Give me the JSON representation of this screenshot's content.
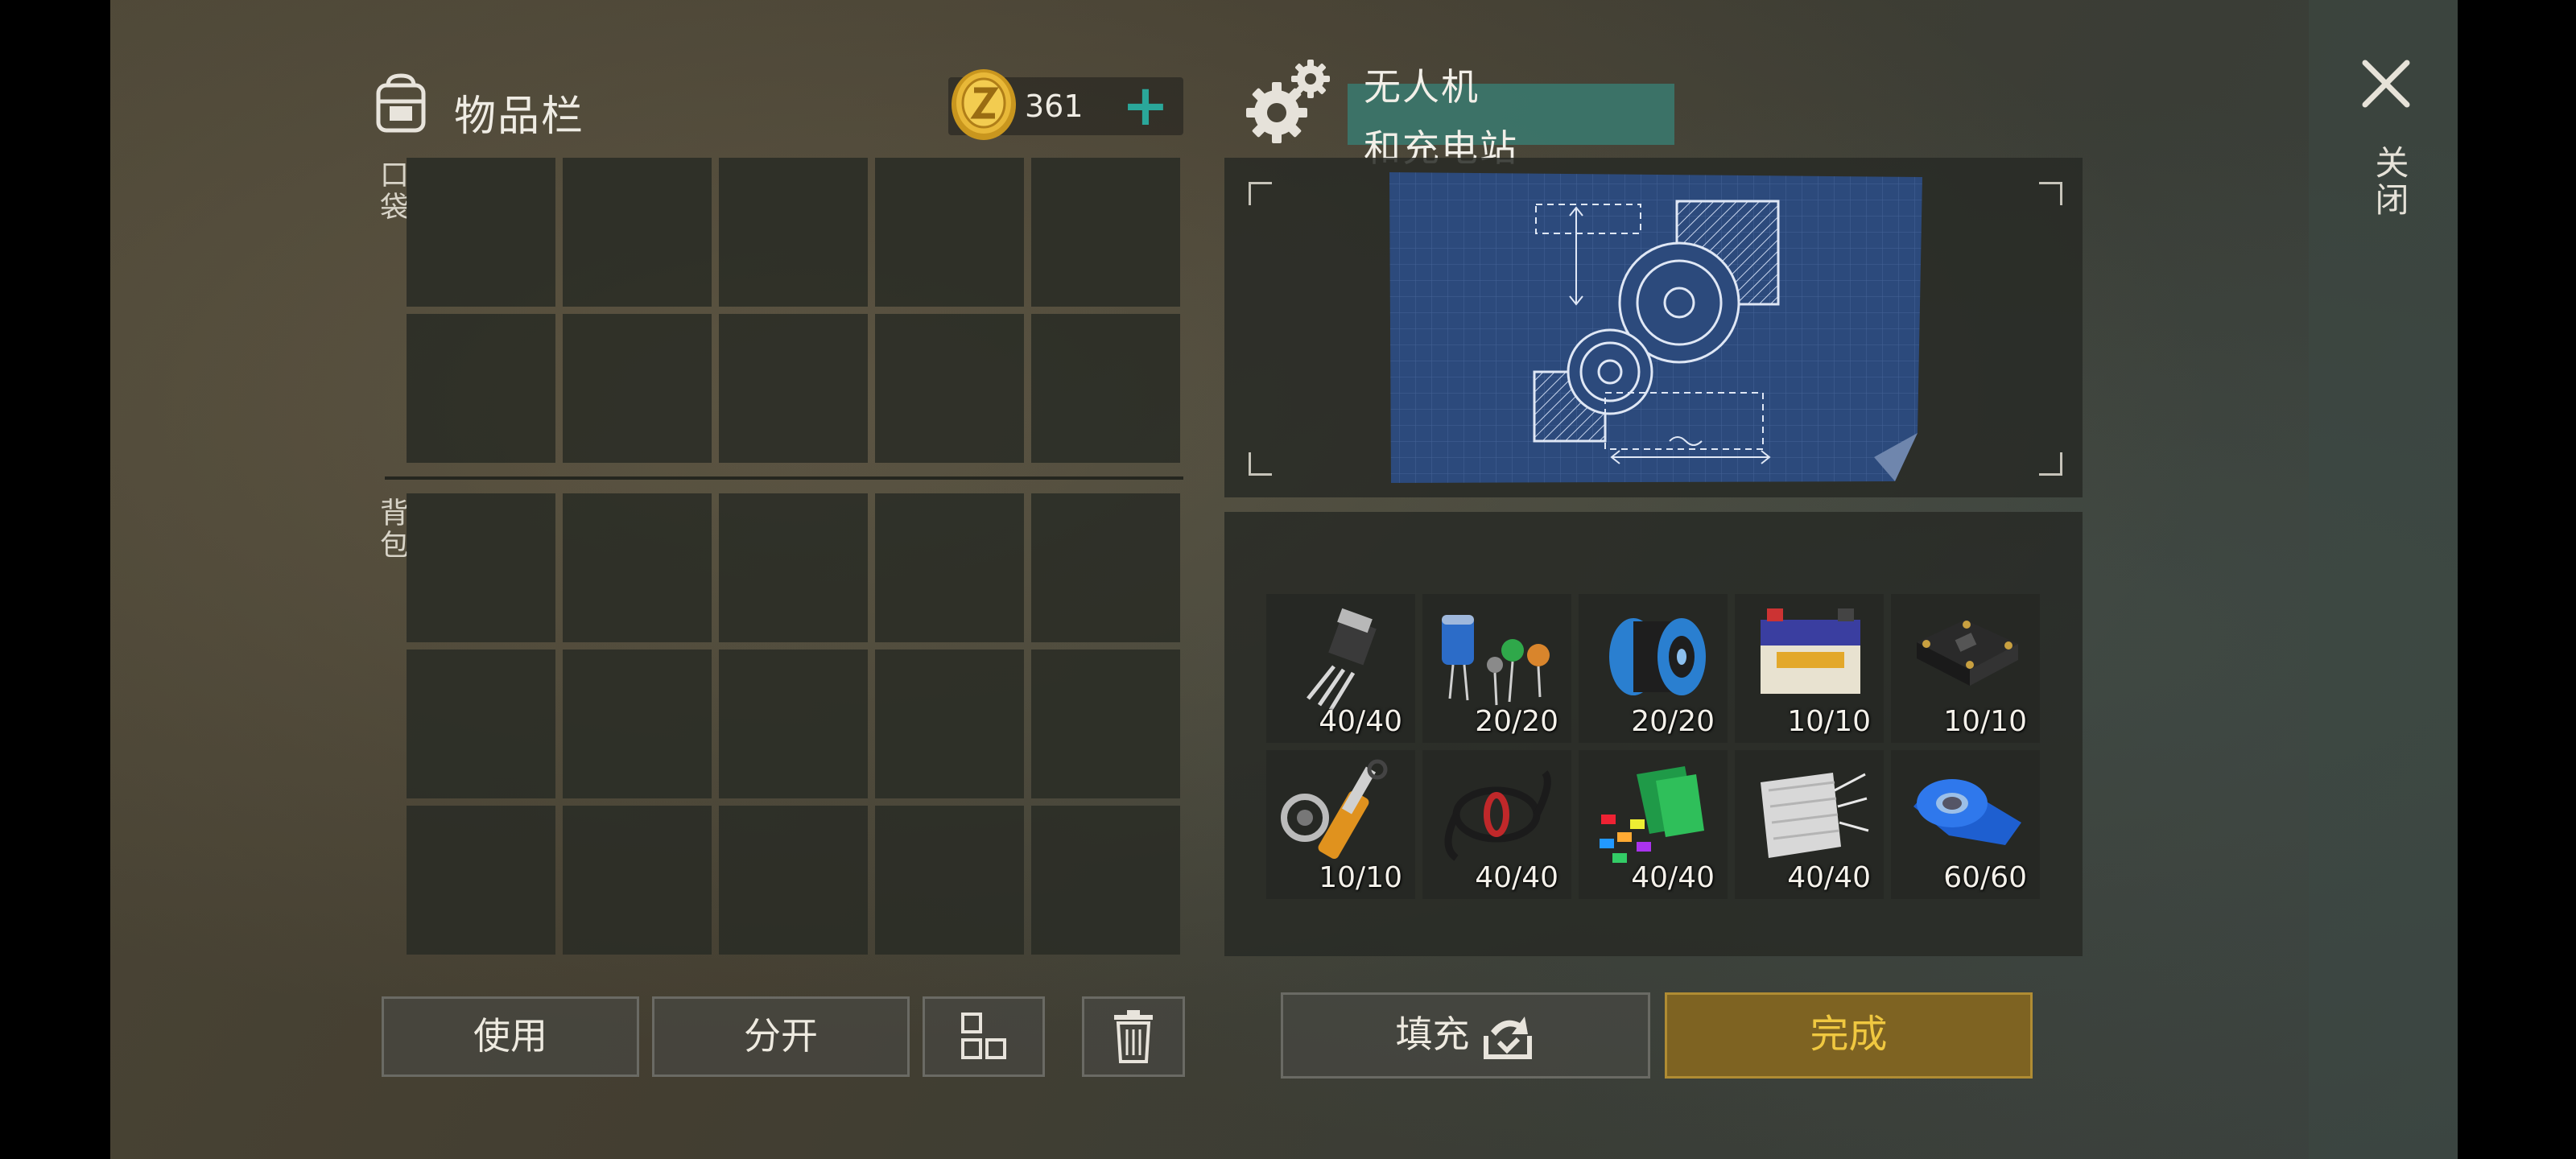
{
  "inventory": {
    "title": "物品栏",
    "coins": "361",
    "pocket_label": "口袋",
    "backpack_label": "背包",
    "buttons": {
      "use": "使用",
      "split": "分开",
      "sort_icon": "grid-icon",
      "trash_icon": "trash-icon"
    }
  },
  "crafting": {
    "title_line1": "无人机",
    "title_line2": "和充电站",
    "ingredients": [
      {
        "icon": "transistor-icon",
        "count": "40/40"
      },
      {
        "icon": "capacitors-icon",
        "count": "20/20"
      },
      {
        "icon": "wire-spool-icon",
        "count": "20/20"
      },
      {
        "icon": "battery-icon",
        "count": "10/10"
      },
      {
        "icon": "circuit-board-icon",
        "count": "10/10"
      },
      {
        "icon": "hydraulic-cylinder-icon",
        "count": "10/10"
      },
      {
        "icon": "cable-icon",
        "count": "40/40"
      },
      {
        "icon": "plastic-parts-icon",
        "count": "40/40"
      },
      {
        "icon": "fiberglass-icon",
        "count": "40/40"
      },
      {
        "icon": "blue-tape-icon",
        "count": "60/60"
      }
    ],
    "fill_label": "填充",
    "done_label": "完成"
  },
  "close_label": "关闭",
  "colors": {
    "accent": "#2aa79a",
    "done_bg": "#7e6322",
    "done_text": "#f0c840",
    "blueprint": "#2c4a7c"
  }
}
